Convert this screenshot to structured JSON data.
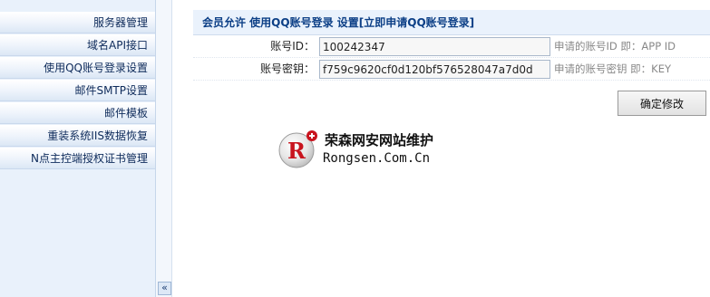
{
  "sidebar": {
    "items": [
      {
        "label": "服务器管理"
      },
      {
        "label": "域名API接口"
      },
      {
        "label": "使用QQ账号登录设置"
      },
      {
        "label": "邮件SMTP设置"
      },
      {
        "label": "邮件模板"
      },
      {
        "label": "重装系统IIS数据恢复"
      },
      {
        "label": "N点主控端授权证书管理"
      }
    ],
    "collapse_glyph": "«"
  },
  "main": {
    "title_prefix": "会员允许 使用QQ账号登录 设置",
    "title_link": "[立即申请QQ账号登录]",
    "rows": [
      {
        "label": "账号ID：",
        "value": "100242347",
        "hint": "申请的账号ID  即：APP ID"
      },
      {
        "label": "账号密钥：",
        "value": "f759c9620cf0d120bf576528047a7d0d",
        "hint": "申请的账号密钥  即：KEY"
      }
    ],
    "submit_label": "确定修改"
  },
  "watermark": {
    "logo_letter": "R",
    "title": "荣森网安网站维护",
    "domain": "Rongsen.Com.Cn"
  },
  "colors": {
    "sidebar_bg": "#e9f1fb",
    "title_text": "#0c3f86",
    "logo_red": "#c8141e"
  }
}
